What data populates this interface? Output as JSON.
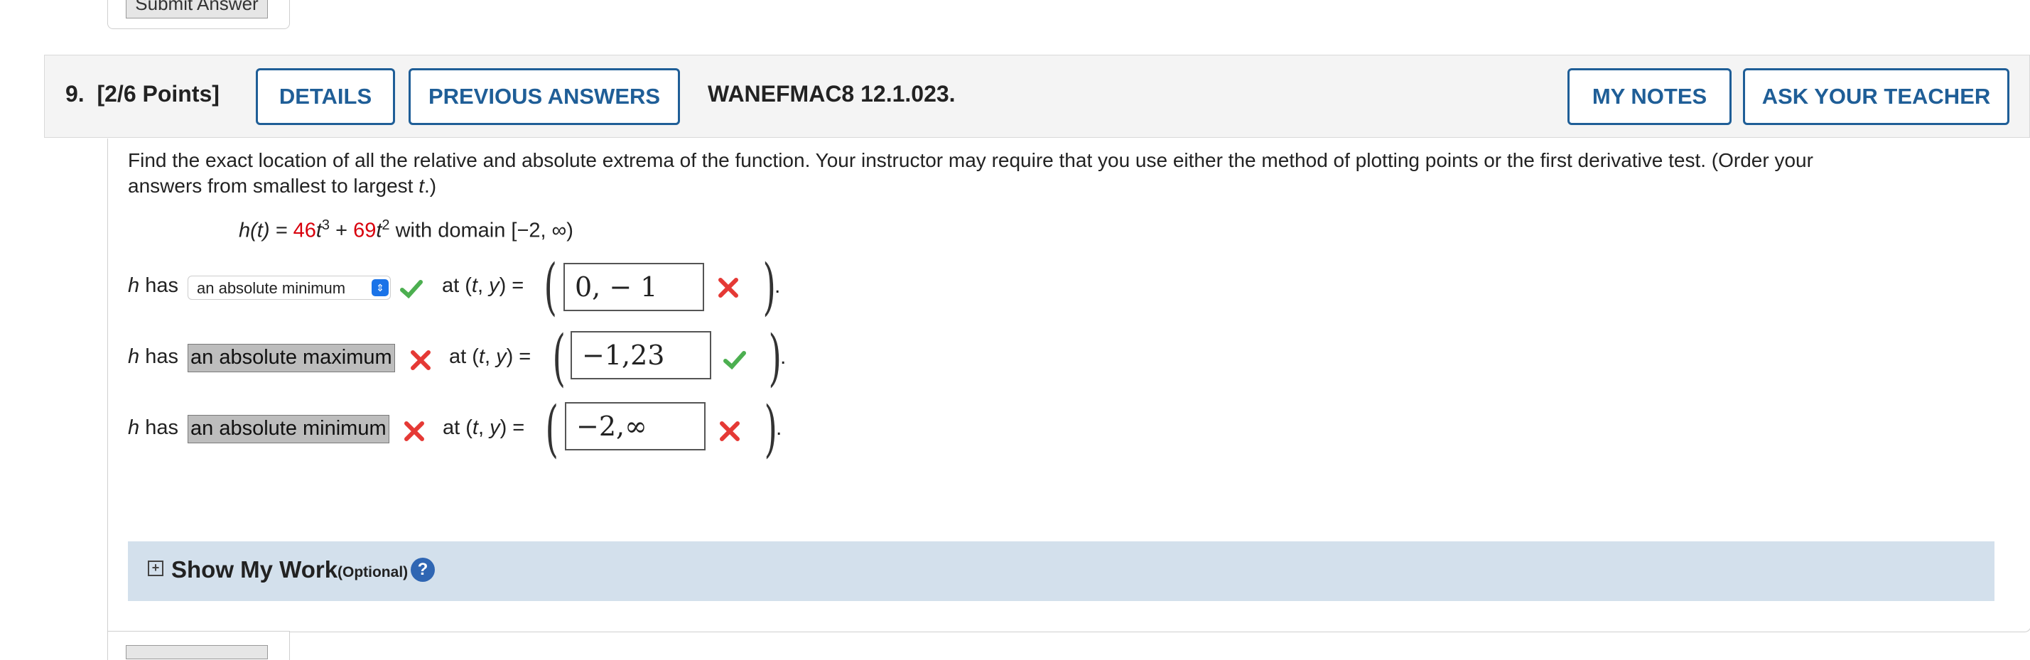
{
  "previous": {
    "submit_label": "Submit Answer"
  },
  "question": {
    "number": "9.",
    "points": "[2/6 Points]",
    "details_label": "DETAILS",
    "previous_answers_label": "PREVIOUS ANSWERS",
    "code": "WANEFMAC8 12.1.023.",
    "my_notes_label": "MY NOTES",
    "ask_teacher_label": "ASK YOUR TEACHER",
    "prompt_line1": "Find the exact location of all the relative and absolute extrema of the function. Your instructor may require that you use either the method of plotting points or the first derivative test. (Order your",
    "prompt_line2_pre": "answers from smallest to largest ",
    "prompt_line2_var": "t",
    "prompt_line2_post": ".)",
    "formula": {
      "lhs": "h(t) = ",
      "coef1": "46",
      "term1": "t",
      "exp1": "3",
      "plus": " + ",
      "coef2": "69",
      "term2": "t",
      "exp2": "2",
      "domain": " with domain [−2, ∞)"
    }
  },
  "answers": [
    {
      "prefix": "h has",
      "extremum": "an absolute minimum",
      "extremum_status": "correct",
      "mid": "at (t, y) =",
      "value": "0, − 1",
      "value_status": "incorrect"
    },
    {
      "prefix": "h has",
      "extremum": "an absolute maximum",
      "extremum_status": "incorrect",
      "mid": "at (t, y) =",
      "value": "−1,23",
      "value_status": "correct"
    },
    {
      "prefix": "h has",
      "extremum": "an absolute minimum",
      "extremum_status": "incorrect",
      "mid": "at (t, y) =",
      "value": "−2,∞",
      "value_status": "incorrect"
    }
  ],
  "show_work": {
    "title": "Show My Work",
    "optional": "(Optional)",
    "help": "?"
  },
  "colors": {
    "accent": "#1f5e97",
    "correct": "#4caf50",
    "incorrect": "#e53935",
    "highlight": "#d8000c"
  }
}
